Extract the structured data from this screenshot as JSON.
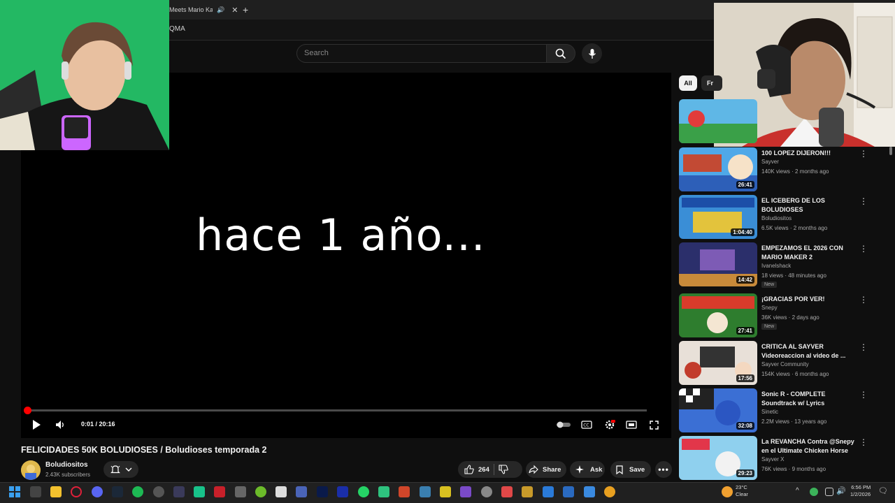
{
  "browser": {
    "tab_title": "Meets Mario Kart",
    "new_tab_symbol": "+",
    "bookmark": "QMA"
  },
  "header": {
    "search_placeholder": "Search"
  },
  "player": {
    "overlay_text": "hace 1 año...",
    "time": "0:01 / 20:16",
    "progress": 0.002
  },
  "video": {
    "title": "FELICIDADES 50K BOLUDIOSES / Boludioses temporada 2",
    "channel": "Boludiositos",
    "subscribers": "2.43K subscribers",
    "likes": "264",
    "share_label": "Share",
    "ask_label": "Ask",
    "save_label": "Save"
  },
  "sidebar": {
    "chips": [
      "All",
      "Fr"
    ],
    "items": [
      {
        "title": "100 LOPEZ DIJERON!!!",
        "channel": "Sayver",
        "meta": "140K views · 2 months ago",
        "duration": "26:41",
        "new": ""
      },
      {
        "title": "EL ICEBERG DE LOS BOLUDIOSES",
        "channel": "Boludiositos",
        "meta": "6.5K views · 2 months ago",
        "duration": "1:04:40",
        "new": ""
      },
      {
        "title": "EMPEZAMOS EL 2026 CON MARIO MAKER 2",
        "channel": "Ivanelshack",
        "meta": "18 views · 48 minutes ago",
        "duration": "14:42",
        "new": "New"
      },
      {
        "title": "¡GRACIAS POR VER!",
        "channel": "Snepy",
        "meta": "36K views · 2 days ago",
        "duration": "27:41",
        "new": "New"
      },
      {
        "title": "CRITICA AL SAYVER Videoreaccion al video de ...",
        "channel": "Sayver Community",
        "meta": "154K views · 6 months ago",
        "duration": "17:56",
        "new": ""
      },
      {
        "title": "Sonic R - COMPLETE Soundtrack w/ Lyrics",
        "channel": "Sinetic",
        "meta": "2.2M views · 13 years ago",
        "duration": "32:08",
        "new": ""
      },
      {
        "title": "La REVANCHA Contra @Snepy en el Ultimate Chicken Horse",
        "channel": "Sayver X",
        "meta": "76K views · 9 months ago",
        "duration": "29:23",
        "new": ""
      }
    ]
  },
  "taskbar": {
    "temperature": "23°C",
    "weather": "Clear",
    "time": "6:56 PM",
    "date": "1/2/2026"
  },
  "colors": {
    "background": "#0f0f0f",
    "accent_red": "#ff0000",
    "greenscreen": "#20b35a"
  }
}
